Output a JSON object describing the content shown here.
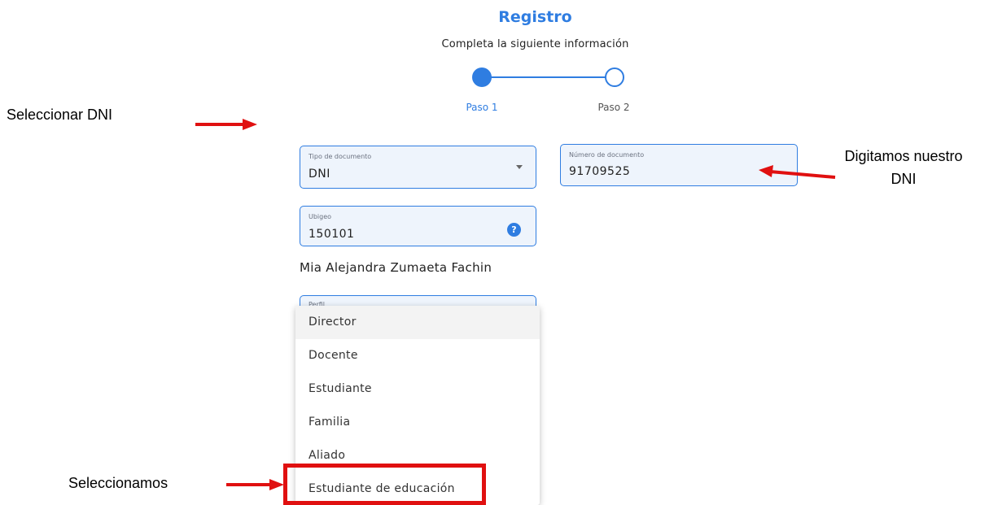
{
  "header": {
    "title": "Registro",
    "subtitle": "Completa la siguiente información"
  },
  "stepper": {
    "steps": [
      {
        "label": "Paso 1",
        "state": "active"
      },
      {
        "label": "Paso 2",
        "state": "inactive"
      }
    ]
  },
  "form": {
    "doc_type": {
      "label": "Tipo de documento",
      "value": "DNI"
    },
    "doc_number": {
      "label": "Número de documento",
      "value": "91709525"
    },
    "ubigeo": {
      "label": "Ubigeo",
      "value": "150101"
    },
    "full_name": "Mia Alejandra Zumaeta Fachin",
    "perfil": {
      "label": "Perfil",
      "options": [
        "Director",
        "Docente",
        "Estudiante",
        "Familia",
        "Aliado",
        "Estudiante de educación"
      ]
    }
  },
  "annotations": {
    "select_dni": "Seleccionar DNI",
    "digit_dni_line1": "Digitamos nuestro",
    "digit_dni_line2": "DNI",
    "select_option": "Seleccionamos"
  },
  "colors": {
    "accent": "#2f7de1",
    "annotation": "#e01010",
    "field_bg": "#eef4fc"
  }
}
